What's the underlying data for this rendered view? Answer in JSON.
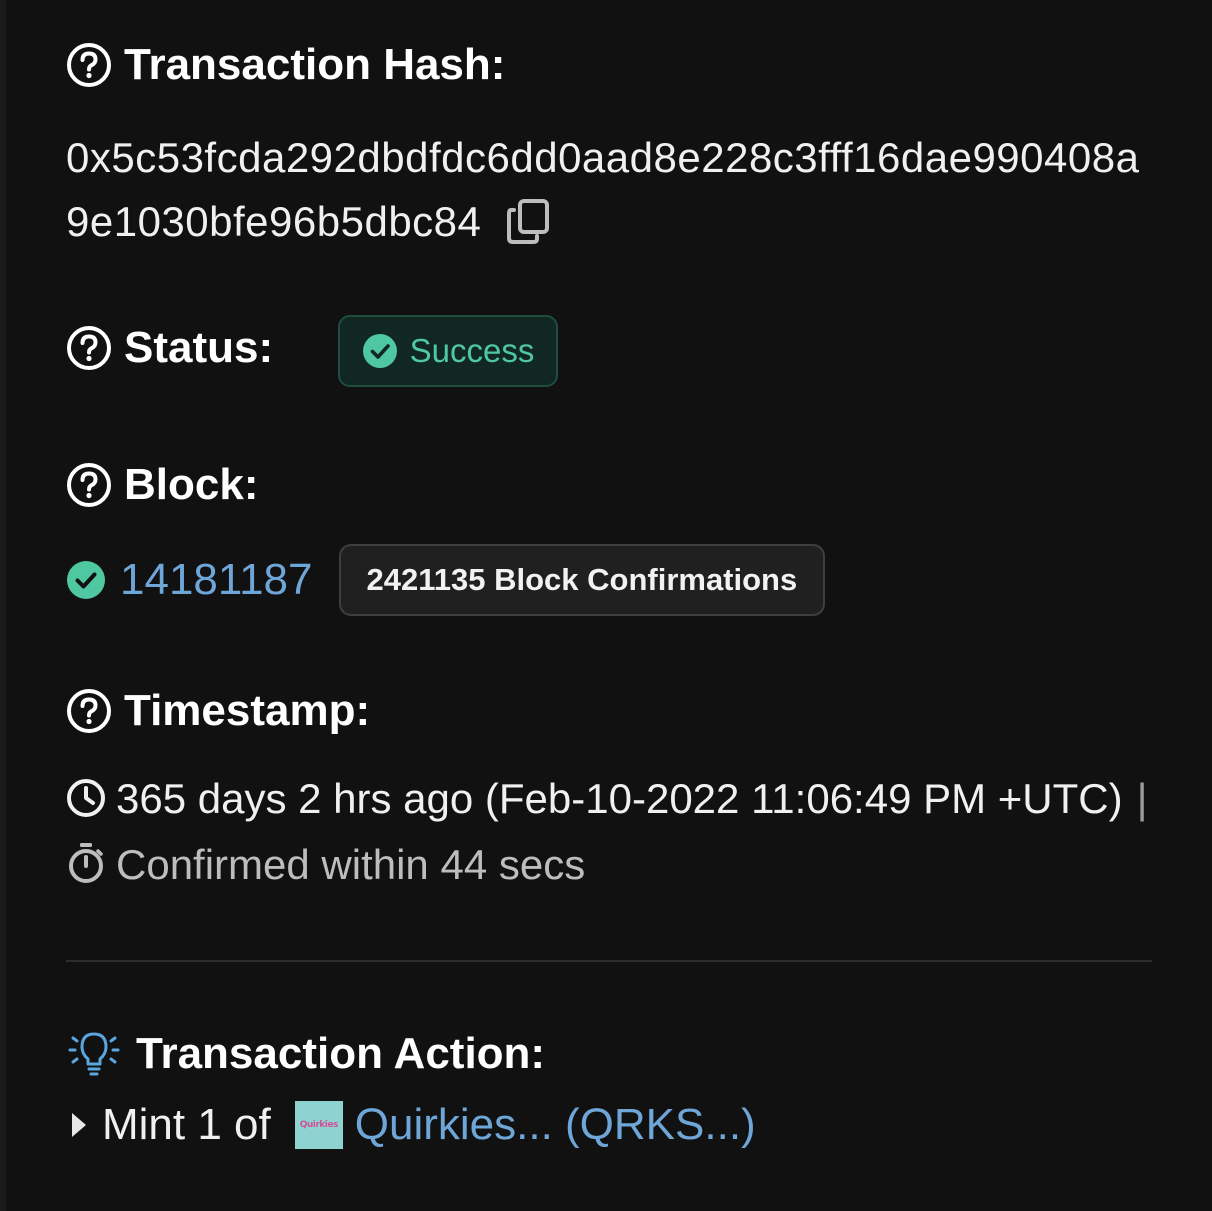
{
  "transaction_hash": {
    "label": "Transaction Hash:",
    "value": "0x5c53fcda292dbdfdc6dd0aad8e228c3fff16dae990408a9e1030bfe96b5dbc84",
    "help_icon": "question-circle-icon",
    "copy_icon": "copy-icon"
  },
  "status": {
    "label": "Status:",
    "badge_text": "Success",
    "badge_icon": "check-circle-icon",
    "badge_color": "#4fc7a0"
  },
  "block": {
    "label": "Block:",
    "number": "14181187",
    "confirmations": "2421135 Block Confirmations",
    "link_color": "#6ea6d8"
  },
  "timestamp": {
    "label": "Timestamp:",
    "age_text": "365 days 2 hrs ago (Feb-10-2022 11:06:49 PM +UTC)",
    "separator": "|",
    "confirmed_text": "Confirmed within 44 secs"
  },
  "transaction_action": {
    "label": "Transaction Action:",
    "icon": "lightbulb-icon",
    "mint_text": "Mint 1 of",
    "token_logo_text": "Quirkies",
    "token_text": "Quirkies... (QRKS...)"
  }
}
